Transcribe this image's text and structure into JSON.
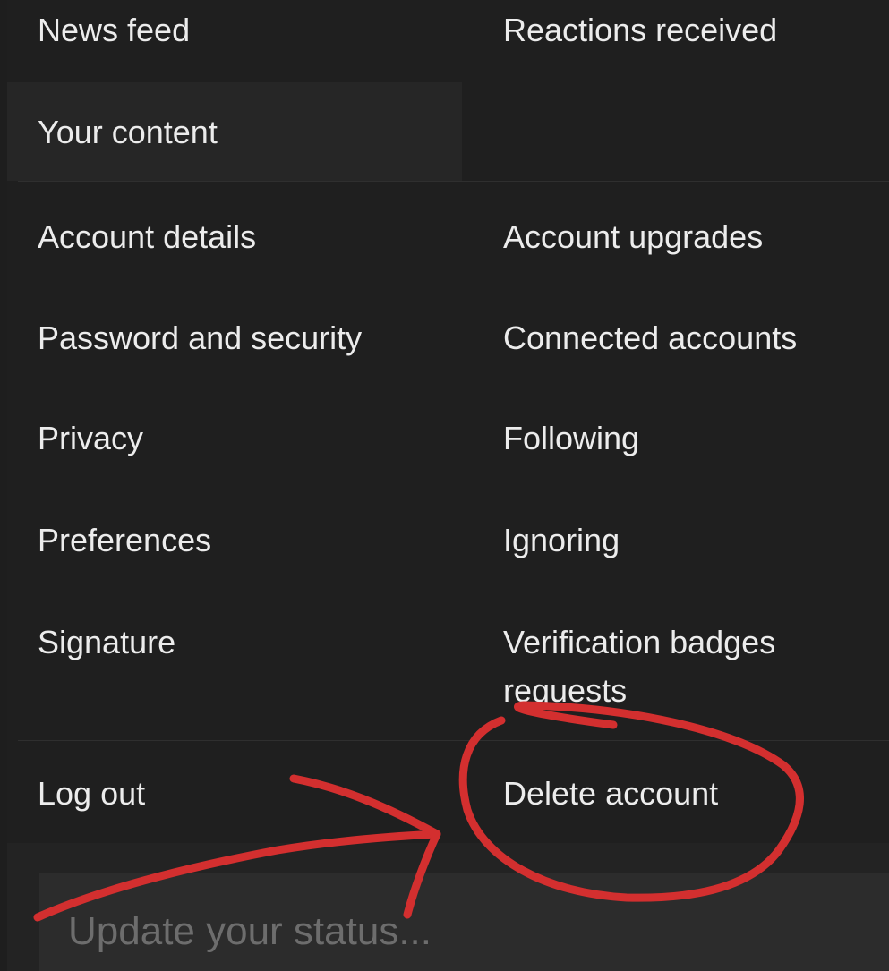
{
  "menu": {
    "news_feed": "News feed",
    "reactions_received": "Reactions received",
    "your_content": "Your content",
    "account_details": "Account details",
    "account_upgrades": "Account upgrades",
    "password_security": "Password and security",
    "connected_accounts": "Connected accounts",
    "privacy": "Privacy",
    "following": "Following",
    "preferences": "Preferences",
    "ignoring": "Ignoring",
    "signature": "Signature",
    "verification_badges": "Verification badges requests",
    "log_out": "Log out",
    "delete_account": "Delete account"
  },
  "status": {
    "placeholder": "Update your status..."
  },
  "colors": {
    "background": "#1f1f1f",
    "highlight": "#262626",
    "text": "#ececec",
    "annotation": "#d32f2f"
  },
  "annotation": {
    "marks": [
      "red-circle",
      "red-arrow"
    ]
  }
}
